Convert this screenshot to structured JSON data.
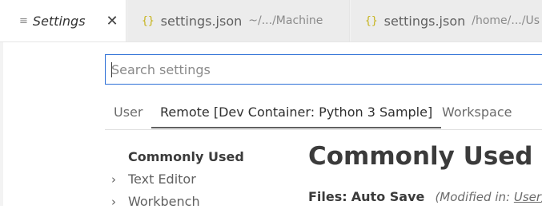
{
  "tabs": [
    {
      "icon": "settings-file-icon",
      "icon_glyph": "≡",
      "label": "Settings",
      "close": "✕"
    },
    {
      "icon": "json-braces-icon",
      "icon_glyph": "{}",
      "label": "settings.json",
      "description": "~/.../Machine"
    },
    {
      "icon": "json-braces-icon",
      "icon_glyph": "{}",
      "label": "settings.json",
      "description": "/home/.../Us"
    }
  ],
  "search": {
    "placeholder": "Search settings",
    "value": ""
  },
  "scopes": [
    "User",
    "Remote [Dev Container: Python 3 Sample]",
    "Workspace"
  ],
  "toc": {
    "items": [
      {
        "label": "Commonly Used",
        "chevron": ""
      },
      {
        "label": "Text Editor",
        "chevron": "›"
      },
      {
        "label": "Workbench",
        "chevron": "›"
      }
    ]
  },
  "main": {
    "section_title": "Commonly Used",
    "setting": {
      "category": "Files:",
      "name": "Auto Save",
      "modified_prefix": "(Modified in:",
      "modified_link": "User",
      "modified_suffix": ")"
    }
  },
  "colors": {
    "accent": "#2c6fd6",
    "json_icon": "#c5b216"
  }
}
